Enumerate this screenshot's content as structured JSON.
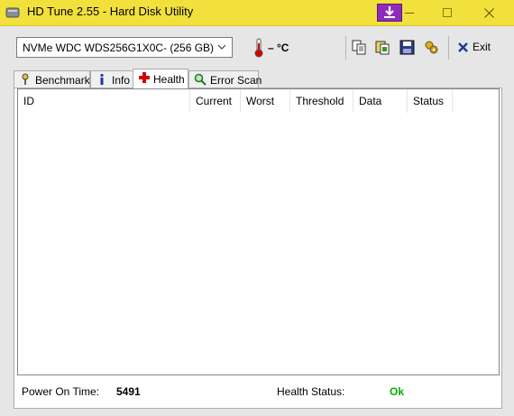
{
  "window": {
    "title": "HD Tune 2.55 - Hard Disk Utility"
  },
  "toolbar": {
    "drive_selected": "NVMe    WDC WDS256G1X0C- (256 GB)",
    "temperature": "– °C",
    "icons": [
      "copy-icon",
      "copy-all-icon",
      "save-icon",
      "options-icon"
    ],
    "exit_label": "Exit"
  },
  "tabs": [
    {
      "label": "Benchmark",
      "icon": "benchmark-icon",
      "active": false
    },
    {
      "label": "Info",
      "icon": "info-icon",
      "active": false
    },
    {
      "label": "Health",
      "icon": "health-cross-icon",
      "active": true
    },
    {
      "label": "Error Scan",
      "icon": "magnifier-icon",
      "active": false
    }
  ],
  "health_table": {
    "columns": [
      "ID",
      "Current",
      "Worst",
      "Threshold",
      "Data",
      "Status"
    ],
    "rows": []
  },
  "footer": {
    "power_on_label": "Power On Time:",
    "power_on_value": "5491",
    "health_status_label": "Health Status:",
    "health_status_value": "Ok"
  },
  "colors": {
    "titlebar": "#f2e03c",
    "pin_button": "#8e2bbd",
    "ok": "#00b000"
  }
}
